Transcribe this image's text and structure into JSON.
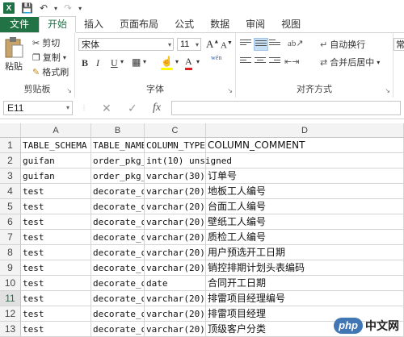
{
  "ribbon_tabs": [
    "文件",
    "开始",
    "插入",
    "页面布局",
    "公式",
    "数据",
    "审阅",
    "视图"
  ],
  "clipboard": {
    "paste": "粘贴",
    "cut": "剪切",
    "copy": "复制",
    "format_painter": "格式刷",
    "label": "剪贴板"
  },
  "font": {
    "name": "宋体",
    "size": "11",
    "label": "字体",
    "increase": "A",
    "decrease": "A",
    "bold": "B",
    "italic": "I",
    "underline": "U",
    "wen": "wén"
  },
  "alignment": {
    "wrap": "自动换行",
    "merge": "合并后居中",
    "label": "对齐方式"
  },
  "number": {
    "format": "常"
  },
  "name_box": "E11",
  "fx": "fx",
  "columns": [
    {
      "letter": "A"
    },
    {
      "letter": "B"
    },
    {
      "letter": "C"
    },
    {
      "letter": "D"
    }
  ],
  "rows": [
    {
      "n": "1",
      "a": "TABLE_SCHEMA",
      "b": "TABLE_NAME",
      "c": "COLUMN_TYPE",
      "d": "COLUMN_COMMENT"
    },
    {
      "n": "2",
      "a": "guifan",
      "b": "order_pkg_",
      "c": "int(10) unsigned",
      "d": ""
    },
    {
      "n": "3",
      "a": "guifan",
      "b": "order_pkg_",
      "c": "varchar(30)",
      "d": "订单号"
    },
    {
      "n": "4",
      "a": "test",
      "b": "decorate_o",
      "c": "varchar(20)",
      "d": "地板工人编号"
    },
    {
      "n": "5",
      "a": "test",
      "b": "decorate_o",
      "c": "varchar(20)",
      "d": "台面工人编号"
    },
    {
      "n": "6",
      "a": "test",
      "b": "decorate_o",
      "c": "varchar(20)",
      "d": "壁纸工人编号"
    },
    {
      "n": "7",
      "a": "test",
      "b": "decorate_o",
      "c": "varchar(20)",
      "d": "质检工人编号"
    },
    {
      "n": "8",
      "a": "test",
      "b": "decorate_o",
      "c": "varchar(20)",
      "d": "用户预选开工日期"
    },
    {
      "n": "9",
      "a": "test",
      "b": "decorate_o",
      "c": "varchar(20)",
      "d": "销控排期计划头表编码"
    },
    {
      "n": "10",
      "a": "test",
      "b": "decorate_o",
      "c": "date",
      "d": "合同开工日期"
    },
    {
      "n": "11",
      "a": "test",
      "b": "decorate_o",
      "c": "varchar(20)",
      "d": "排雷项目经理编号"
    },
    {
      "n": "12",
      "a": "test",
      "b": "decorate_o",
      "c": "varchar(20)",
      "d": "排雷项目经理"
    },
    {
      "n": "13",
      "a": "test",
      "b": "decorate_o",
      "c": "varchar(20)",
      "d": "顶级客户分类"
    }
  ],
  "watermark": {
    "logo": "php",
    "text": "中文网"
  }
}
